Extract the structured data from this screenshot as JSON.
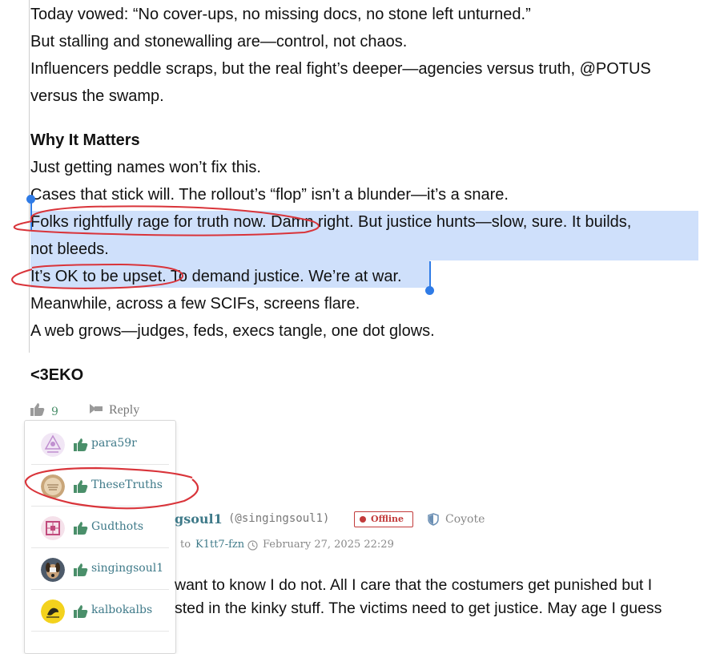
{
  "post": {
    "lines": [
      "Today vowed: “No cover-ups, no missing docs, no stone left unturned.”",
      "But stalling and stonewalling are—control, not chaos.",
      "Influencers peddle scraps, but the real fight’s deeper—agencies versus truth, @POTUS",
      "versus the swamp."
    ],
    "section_heading": "Why It Matters",
    "lines2": [
      "Just getting names won’t fix this.",
      "Cases that stick will. The rollout’s “flop” isn’t a blunder—it’s a snare.",
      "Folks rightfully rage for truth now. Damn right. But justice hunts—slow, sure. It builds,",
      "not bleeds.",
      "It’s OK to be upset. To demand justice. We’re at war.",
      "Meanwhile, across a few SCIFs, screens flare.",
      "A web grows—judges, feds, execs tangle, one dot glows."
    ],
    "signature": "<3EKO"
  },
  "actions": {
    "like_count": "9",
    "reply_label": "Reply"
  },
  "likers": [
    {
      "username": "para59r",
      "avatar_icon": "purple-pattern-avatar"
    },
    {
      "username": "TheseTruths",
      "avatar_icon": "seal-avatar"
    },
    {
      "username": "Gudthots",
      "avatar_icon": "pink-pattern-avatar"
    },
    {
      "username": "singingsoul1",
      "avatar_icon": "dog-avatar"
    },
    {
      "username": "kalbokalbs",
      "avatar_icon": "yellow-flag-avatar"
    }
  ],
  "comment": {
    "author_fragment": "gsoul1",
    "handle": "(@singingsoul1)",
    "status": "Offline",
    "badge_label": "Coyote",
    "reply_to_prefix": "to",
    "reply_to_user": "K1tt7-fzn",
    "timestamp": "February 27, 2025 22:29",
    "body_lines": [
      "want to know I do not. All I care that the costumers get punished but I",
      "sted in the kinky stuff. The victims need to get justice. May age I guess"
    ]
  },
  "colors": {
    "selection": "#cfe0fb",
    "handle": "#2f7be6",
    "annotation": "#d9343a",
    "username": "#3f7a89",
    "like_green": "#4a8f6a",
    "offline_red": "#c23b3b"
  }
}
